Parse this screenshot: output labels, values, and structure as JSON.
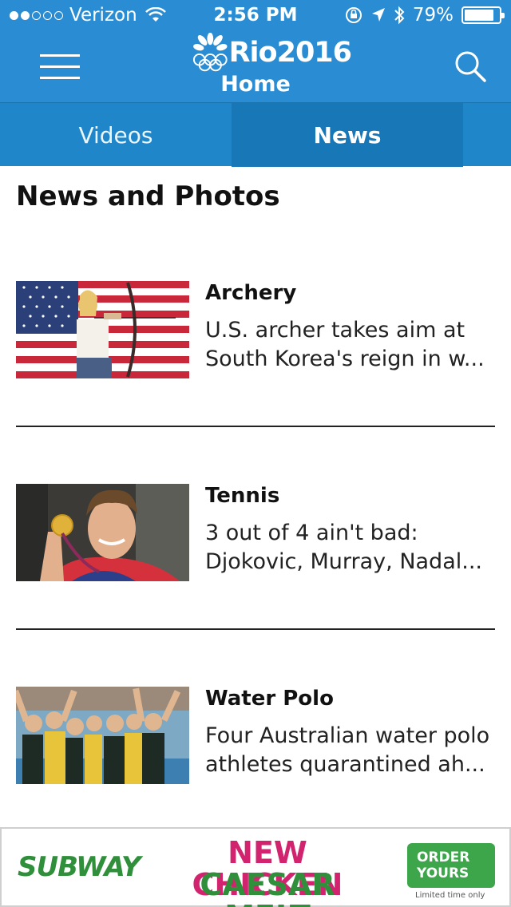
{
  "status_bar": {
    "carrier": "Verizon",
    "time": "2:56 PM",
    "battery": "79%",
    "battery_level": 0.79
  },
  "header": {
    "logo_text": "Rio2016",
    "title": "Home",
    "icons": [
      "menu-icon",
      "search-icon"
    ]
  },
  "tabs": [
    {
      "label": "Videos",
      "selected": false
    },
    {
      "label": "News",
      "selected": true
    }
  ],
  "section_title": "News and Photos",
  "articles": [
    {
      "category": "Archery",
      "headline": "U.S. archer takes aim at South Korea's reign in w..."
    },
    {
      "category": "Tennis",
      "headline": "3 out of 4 ain't bad: Djokovic, Murray, Nadal..."
    },
    {
      "category": "Water Polo",
      "headline": "Four Australian water polo athletes quarantined ah..."
    }
  ],
  "ad": {
    "brand": "SUBWAY",
    "line1": "NEW CHICKEN",
    "line2": "CAESAR MELT",
    "cta": "ORDER YOURS",
    "fine_print": "Limited time only"
  },
  "colors": {
    "header_blue": "#2a8cd2",
    "tab_selected": "#1877b7",
    "subway_green": "#2f8f3a",
    "promo_pink": "#d2236f"
  }
}
